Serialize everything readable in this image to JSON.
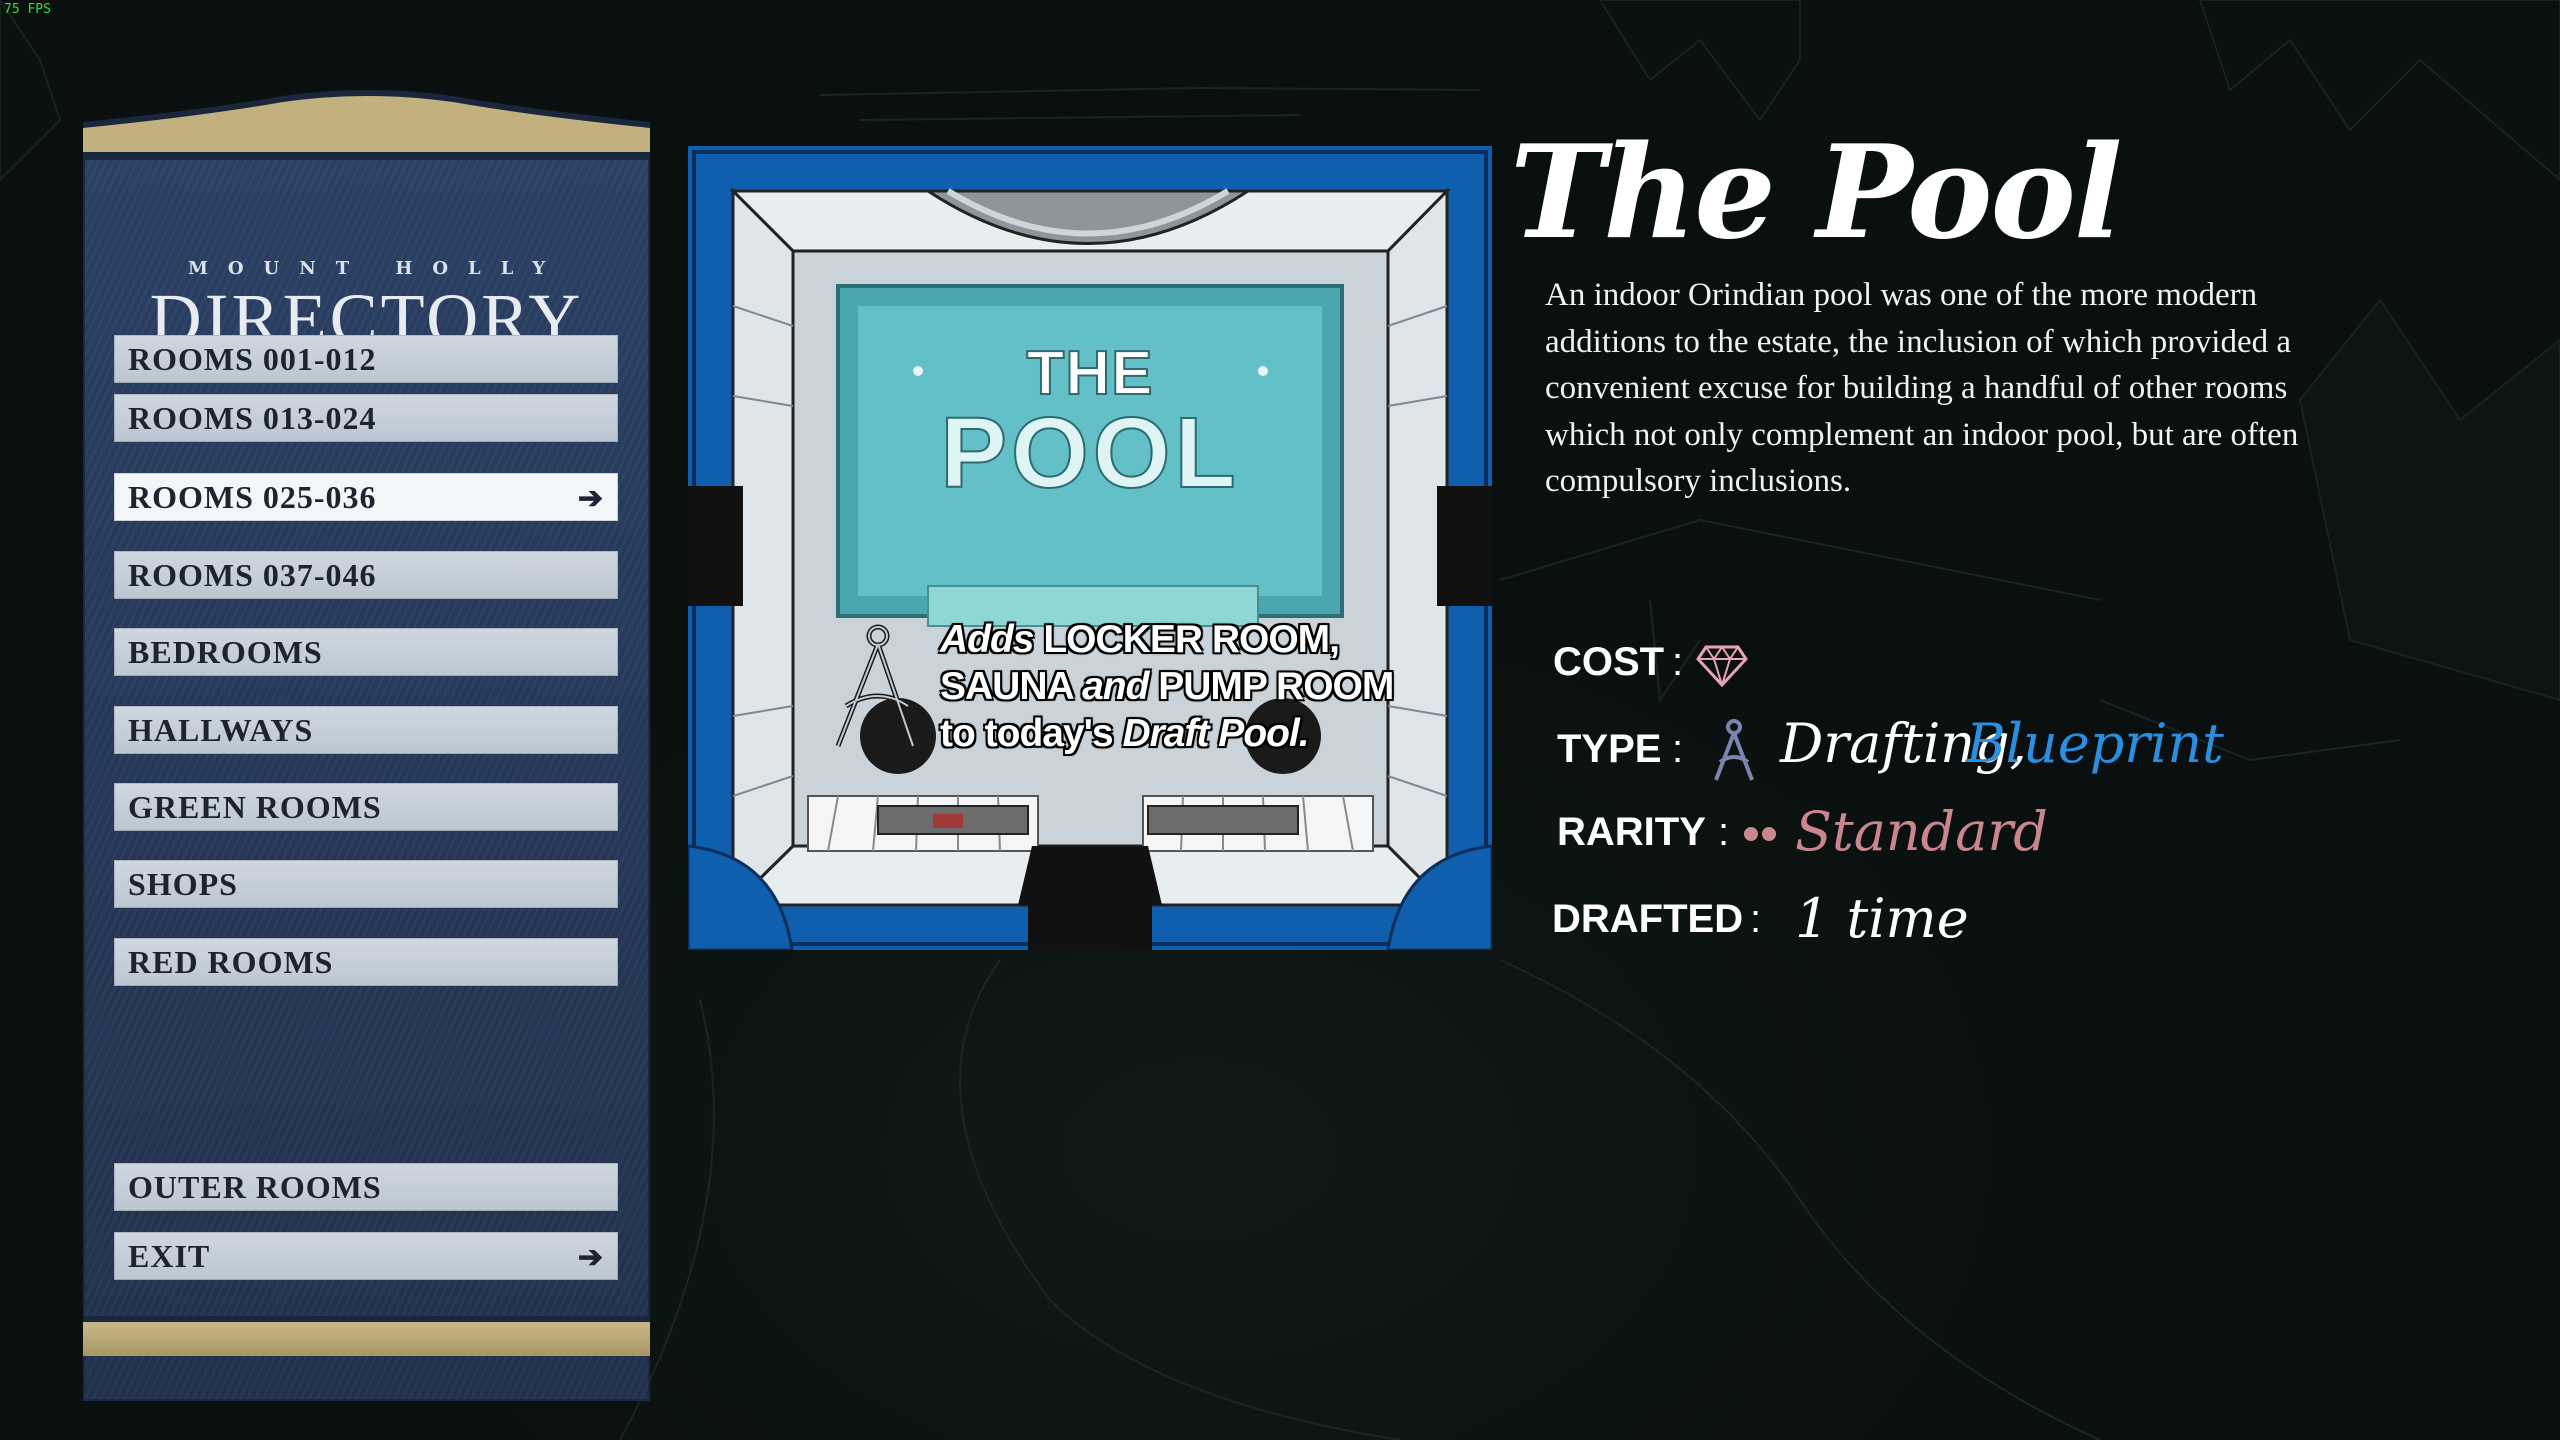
{
  "fps": "75 FPS",
  "directory": {
    "subtitle": "MOUNT HOLLY",
    "title": "DIRECTORY",
    "items": [
      {
        "label": "ROOMS 001-012",
        "selected": false
      },
      {
        "label": "ROOMS 013-024",
        "selected": false
      },
      {
        "label": "ROOMS 025-036",
        "selected": true
      },
      {
        "label": "ROOMS 037-046",
        "selected": false
      },
      {
        "label": "BEDROOMS",
        "selected": false
      },
      {
        "label": "HALLWAYS",
        "selected": false
      },
      {
        "label": "GREEN ROOMS",
        "selected": false
      },
      {
        "label": "SHOPS",
        "selected": false
      },
      {
        "label": "RED ROOMS",
        "selected": false
      },
      {
        "label": "OUTER ROOMS",
        "selected": false
      },
      {
        "label": "EXIT",
        "selected": false
      }
    ],
    "arrow_glyph": "➔"
  },
  "card": {
    "name_line1": "THE",
    "name_line2": "POOL",
    "effect_line1_a": "Adds",
    "effect_line1_b": " LOCKER ROOM,",
    "effect_line2_a": "SAUNA ",
    "effect_line2_b": "and",
    "effect_line2_c": " PUMP ROOM",
    "effect_line3_a": "to today's ",
    "effect_line3_b": "Draft Pool."
  },
  "room": {
    "title": "The Pool",
    "description": "An indoor Orindian pool was one of the more modern additions to the estate, the inclusion of which provided a convenient excuse for building a handful of other rooms which not only complement an indoor pool, but are often compulsory inclusions.",
    "stats": {
      "cost_label": "COST",
      "cost_icon": "gem-icon",
      "type_label": "TYPE",
      "type_value_1": "Drafting,",
      "type_value_2": "Blueprint",
      "rarity_label": "RARITY",
      "rarity_value": "Standard",
      "drafted_label": "DRAFTED",
      "drafted_value": "1 time",
      "separator": ":"
    },
    "colors": {
      "blueprint": "#2a8fe0",
      "rarity": "#c9868c",
      "gem": "#e9a3b8"
    }
  }
}
